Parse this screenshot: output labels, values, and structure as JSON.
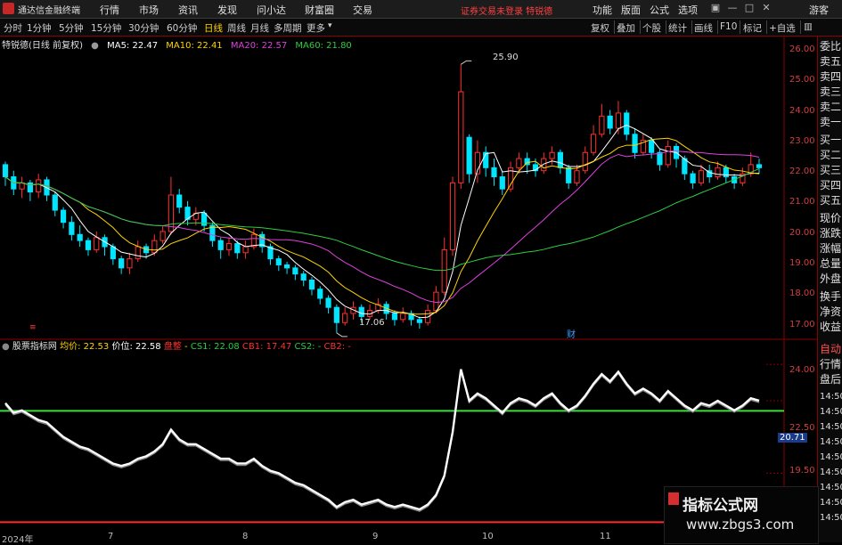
{
  "menubar": {
    "title": "通达信金融终端",
    "items": [
      "行情",
      "市场",
      "资讯",
      "发现",
      "问小达",
      "财富圈",
      "交易"
    ],
    "notice": "证券交易未登录  特锐德",
    "right_items": [
      "功能",
      "版面",
      "公式",
      "选项"
    ],
    "guest": "游客"
  },
  "periodbar": {
    "periods": [
      "分时",
      "1分钟",
      "5分钟",
      "15分钟",
      "30分钟",
      "60分钟",
      "日线",
      "周线",
      "月线",
      "多周期",
      "更多"
    ],
    "active": "日线",
    "tools": [
      "复权",
      "叠加",
      "个股",
      "统计",
      "画线",
      "F10",
      "标记",
      "+自选"
    ]
  },
  "kline_header": {
    "stock": "特锐德(日线 前复权)",
    "ma5": "MA5: 22.47",
    "ma10": "MA10: 22.41",
    "ma20": "MA20: 22.57",
    "ma60": "MA60: 21.80"
  },
  "price_axis": [
    "26.00",
    "25.00",
    "24.00",
    "23.00",
    "22.00",
    "21.00",
    "20.00",
    "19.00",
    "18.00",
    "17.00"
  ],
  "annotations": {
    "high": "25.90",
    "low": "17.06",
    "marker_caiwu": "财",
    "marker_left": "≡"
  },
  "indicator_header": {
    "name": "股票指标网",
    "avg": "均价: 22.53",
    "price": "价位: 22.58",
    "signal": "盘整",
    "cs1": "CS1: 22.08",
    "cb1": "CB1: 17.47",
    "cs2": "CS2: -",
    "cb2": "CB2: -"
  },
  "indicator_axis": [
    "24.00",
    "22.50",
    "19.50"
  ],
  "indicator_current": "20.71",
  "side_panel": [
    "委比",
    "卖五",
    "卖四",
    "卖三",
    "卖二",
    "卖一",
    "买一",
    "买二",
    "买三",
    "买四",
    "买五",
    "现价",
    "涨跌",
    "涨幅",
    "总量",
    "外盘",
    "换手",
    "净资",
    "收益",
    "自动",
    "行情",
    "盘后"
  ],
  "side_times": [
    "14:50",
    "14:50",
    "14:50",
    "14:50",
    "14:50",
    "14:50",
    "14:50",
    "14:50",
    "14:50"
  ],
  "dates": [
    "2024年",
    "7",
    "8",
    "9",
    "10",
    "11"
  ],
  "watermark": {
    "line1": "指标公式网",
    "line2": "www.zbgs3.com"
  },
  "colors": {
    "up": "#ff3030",
    "down": "#00e5ff",
    "ma5": "#ffffff",
    "ma10": "#ffd400",
    "ma20": "#e040e0",
    "ma60": "#2ecc40",
    "line_green": "#3ddc3d",
    "line_red": "#ff2a2a"
  },
  "chart_data": {
    "type": "candlestick",
    "title": "特锐德(日线 前复权)",
    "ylim": [
      17.0,
      26.0
    ],
    "candles": [
      [
        22.6,
        22.2,
        22.7,
        21.9
      ],
      [
        22.2,
        21.8,
        22.4,
        21.6
      ],
      [
        21.8,
        22.0,
        22.2,
        21.5
      ],
      [
        22.0,
        21.7,
        22.1,
        21.4
      ],
      [
        21.7,
        22.1,
        22.3,
        21.5
      ],
      [
        22.1,
        21.6,
        22.2,
        21.4
      ],
      [
        21.6,
        21.1,
        21.7,
        20.9
      ],
      [
        21.1,
        20.7,
        21.2,
        20.5
      ],
      [
        20.7,
        20.3,
        20.9,
        20.1
      ],
      [
        20.3,
        20.1,
        20.6,
        19.9
      ],
      [
        20.1,
        19.8,
        20.2,
        19.6
      ],
      [
        19.8,
        20.2,
        20.4,
        19.7
      ],
      [
        20.2,
        19.9,
        20.3,
        19.6
      ],
      [
        19.9,
        19.5,
        20.0,
        19.3
      ],
      [
        19.5,
        19.2,
        19.6,
        19.0
      ],
      [
        19.2,
        19.5,
        19.7,
        19.0
      ],
      [
        19.5,
        19.9,
        20.1,
        19.4
      ],
      [
        19.9,
        19.7,
        20.0,
        19.5
      ],
      [
        19.7,
        20.1,
        20.3,
        19.6
      ],
      [
        20.1,
        20.4,
        20.6,
        20.0
      ],
      [
        20.4,
        21.6,
        22.2,
        20.3
      ],
      [
        21.6,
        21.2,
        21.8,
        21.0
      ],
      [
        21.2,
        20.8,
        21.4,
        20.6
      ],
      [
        20.8,
        21.0,
        21.2,
        20.6
      ],
      [
        21.0,
        20.6,
        21.1,
        20.4
      ],
      [
        20.6,
        20.1,
        20.7,
        19.9
      ],
      [
        20.1,
        19.8,
        20.2,
        19.5
      ],
      [
        19.8,
        20.0,
        20.2,
        19.6
      ],
      [
        20.0,
        19.7,
        20.1,
        19.5
      ],
      [
        19.7,
        19.9,
        20.1,
        19.5
      ],
      [
        19.9,
        20.3,
        20.5,
        19.8
      ],
      [
        20.3,
        19.9,
        20.4,
        19.7
      ],
      [
        19.9,
        19.5,
        20.0,
        19.3
      ],
      [
        19.5,
        19.3,
        19.6,
        19.1
      ],
      [
        19.3,
        19.2,
        19.4,
        19.0
      ],
      [
        19.2,
        19.0,
        19.3,
        18.8
      ],
      [
        19.0,
        18.8,
        19.1,
        18.6
      ],
      [
        18.8,
        18.5,
        18.9,
        18.3
      ],
      [
        18.5,
        18.2,
        18.6,
        18.0
      ],
      [
        18.2,
        17.9,
        18.3,
        17.7
      ],
      [
        17.9,
        17.4,
        18.0,
        17.06
      ],
      [
        17.4,
        17.7,
        17.9,
        17.3
      ],
      [
        17.7,
        17.9,
        18.1,
        17.5
      ],
      [
        17.9,
        17.6,
        18.0,
        17.4
      ],
      [
        17.6,
        17.8,
        18.0,
        17.5
      ],
      [
        17.8,
        18.0,
        18.2,
        17.7
      ],
      [
        18.0,
        17.7,
        18.1,
        17.5
      ],
      [
        17.7,
        17.5,
        17.8,
        17.3
      ],
      [
        17.5,
        17.7,
        17.9,
        17.4
      ],
      [
        17.7,
        17.5,
        17.8,
        17.3
      ],
      [
        17.5,
        17.4,
        17.6,
        17.2
      ],
      [
        17.4,
        17.8,
        18.0,
        17.3
      ],
      [
        17.8,
        18.4,
        18.6,
        17.7
      ],
      [
        18.4,
        19.8,
        20.2,
        18.3
      ],
      [
        19.8,
        22.0,
        22.2,
        19.6
      ],
      [
        22.0,
        25.0,
        25.9,
        21.8
      ],
      [
        23.5,
        22.3,
        23.6,
        22.0
      ],
      [
        22.3,
        23.0,
        23.4,
        22.0
      ],
      [
        23.0,
        22.5,
        23.2,
        22.2
      ],
      [
        22.5,
        22.2,
        22.8,
        21.9
      ],
      [
        22.2,
        21.8,
        22.4,
        21.6
      ],
      [
        21.8,
        22.5,
        22.7,
        21.7
      ],
      [
        22.5,
        22.8,
        23.0,
        22.3
      ],
      [
        22.8,
        22.6,
        23.0,
        22.3
      ],
      [
        22.6,
        22.4,
        22.8,
        22.2
      ],
      [
        22.4,
        22.8,
        23.0,
        22.3
      ],
      [
        22.8,
        23.0,
        23.2,
        22.6
      ],
      [
        23.0,
        22.5,
        23.1,
        22.3
      ],
      [
        22.5,
        22.0,
        22.6,
        21.8
      ],
      [
        22.0,
        22.4,
        22.6,
        21.9
      ],
      [
        22.4,
        23.0,
        23.2,
        22.3
      ],
      [
        23.0,
        23.6,
        23.9,
        22.9
      ],
      [
        23.6,
        24.2,
        24.6,
        23.5
      ],
      [
        24.2,
        23.8,
        24.4,
        23.6
      ],
      [
        23.8,
        24.3,
        24.7,
        23.6
      ],
      [
        24.3,
        23.6,
        24.4,
        23.4
      ],
      [
        23.6,
        23.0,
        23.8,
        22.8
      ],
      [
        23.0,
        23.4,
        23.6,
        22.9
      ],
      [
        23.4,
        23.0,
        23.5,
        22.8
      ],
      [
        23.0,
        22.6,
        23.1,
        22.4
      ],
      [
        22.6,
        23.2,
        23.4,
        22.5
      ],
      [
        23.2,
        22.8,
        23.3,
        22.5
      ],
      [
        22.8,
        22.3,
        22.9,
        22.1
      ],
      [
        22.3,
        22.0,
        22.4,
        21.8
      ],
      [
        22.0,
        22.4,
        22.6,
        21.9
      ],
      [
        22.4,
        22.2,
        22.6,
        22.0
      ],
      [
        22.2,
        22.5,
        22.7,
        22.1
      ],
      [
        22.5,
        22.2,
        22.6,
        22.0
      ],
      [
        22.2,
        22.0,
        22.3,
        21.8
      ],
      [
        22.0,
        22.3,
        22.5,
        21.9
      ],
      [
        22.3,
        22.6,
        23.0,
        22.2
      ],
      [
        22.6,
        22.5,
        22.8,
        22.3
      ]
    ],
    "indicator_line": [
      22.4,
      22.0,
      22.1,
      21.9,
      21.7,
      21.6,
      21.3,
      21.0,
      20.8,
      20.6,
      20.5,
      20.3,
      20.1,
      19.9,
      19.8,
      19.9,
      20.1,
      20.2,
      20.4,
      20.7,
      21.3,
      20.9,
      20.7,
      20.7,
      20.5,
      20.3,
      20.1,
      20.1,
      19.9,
      19.9,
      20.1,
      19.8,
      19.6,
      19.5,
      19.3,
      19.1,
      19.0,
      18.8,
      18.6,
      18.4,
      18.1,
      18.3,
      18.4,
      18.2,
      18.3,
      18.4,
      18.2,
      18.1,
      18.2,
      18.1,
      18.0,
      18.2,
      18.6,
      19.4,
      21.2,
      23.8,
      22.5,
      22.8,
      22.6,
      22.3,
      22.0,
      22.4,
      22.6,
      22.5,
      22.3,
      22.6,
      22.8,
      22.4,
      22.1,
      22.3,
      22.7,
      23.2,
      23.6,
      23.3,
      23.7,
      23.2,
      22.8,
      23.0,
      22.8,
      22.5,
      22.9,
      22.6,
      22.3,
      22.1,
      22.4,
      22.3,
      22.5,
      22.3,
      22.1,
      22.3,
      22.6,
      22.5
    ],
    "cs1": 22.08,
    "cb1": 17.47
  }
}
